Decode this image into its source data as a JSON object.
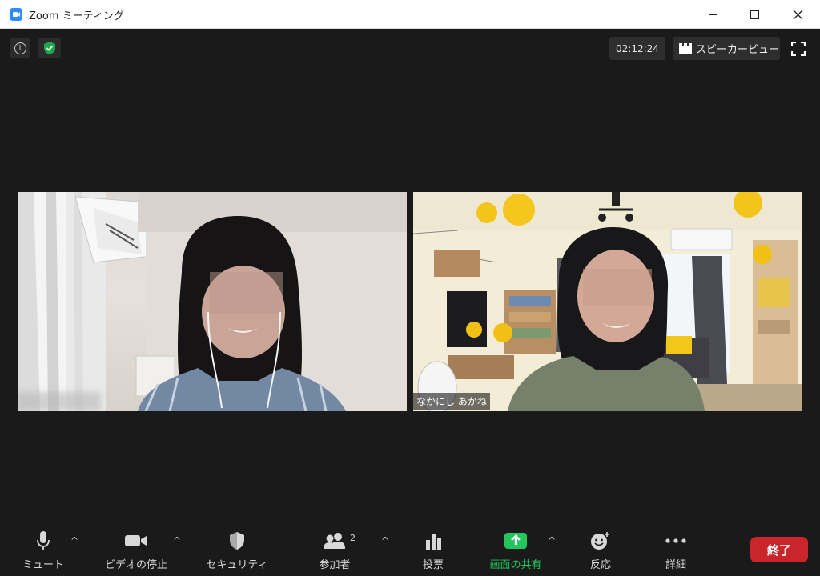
{
  "window": {
    "title": "Zoom ミーティング"
  },
  "meeting": {
    "timer": "02:12:24",
    "view_label": "スピーカービュー"
  },
  "participants": [
    {
      "name": ""
    },
    {
      "name": "なかにし あかね"
    }
  ],
  "toolbar": {
    "mute_label": "ミュート",
    "video_label": "ビデオの停止",
    "security_label": "セキュリティ",
    "participants_label": "参加者",
    "participants_count": "2",
    "poll_label": "投票",
    "share_label": "画面の共有",
    "reactions_label": "反応",
    "more_label": "詳細",
    "end_label": "終了"
  },
  "colors": {
    "background": "#1a1a1a",
    "share_green": "#22c55e",
    "end_red": "#c9252b",
    "security_green": "#1ea64a"
  },
  "icons": [
    "zoom-app-icon",
    "info-icon",
    "shield-check-icon",
    "grid-icon",
    "fullscreen-icon",
    "microphone-icon",
    "camera-icon",
    "security-shield-icon",
    "participants-icon",
    "poll-icon",
    "share-screen-icon",
    "reaction-icon",
    "more-icon"
  ]
}
